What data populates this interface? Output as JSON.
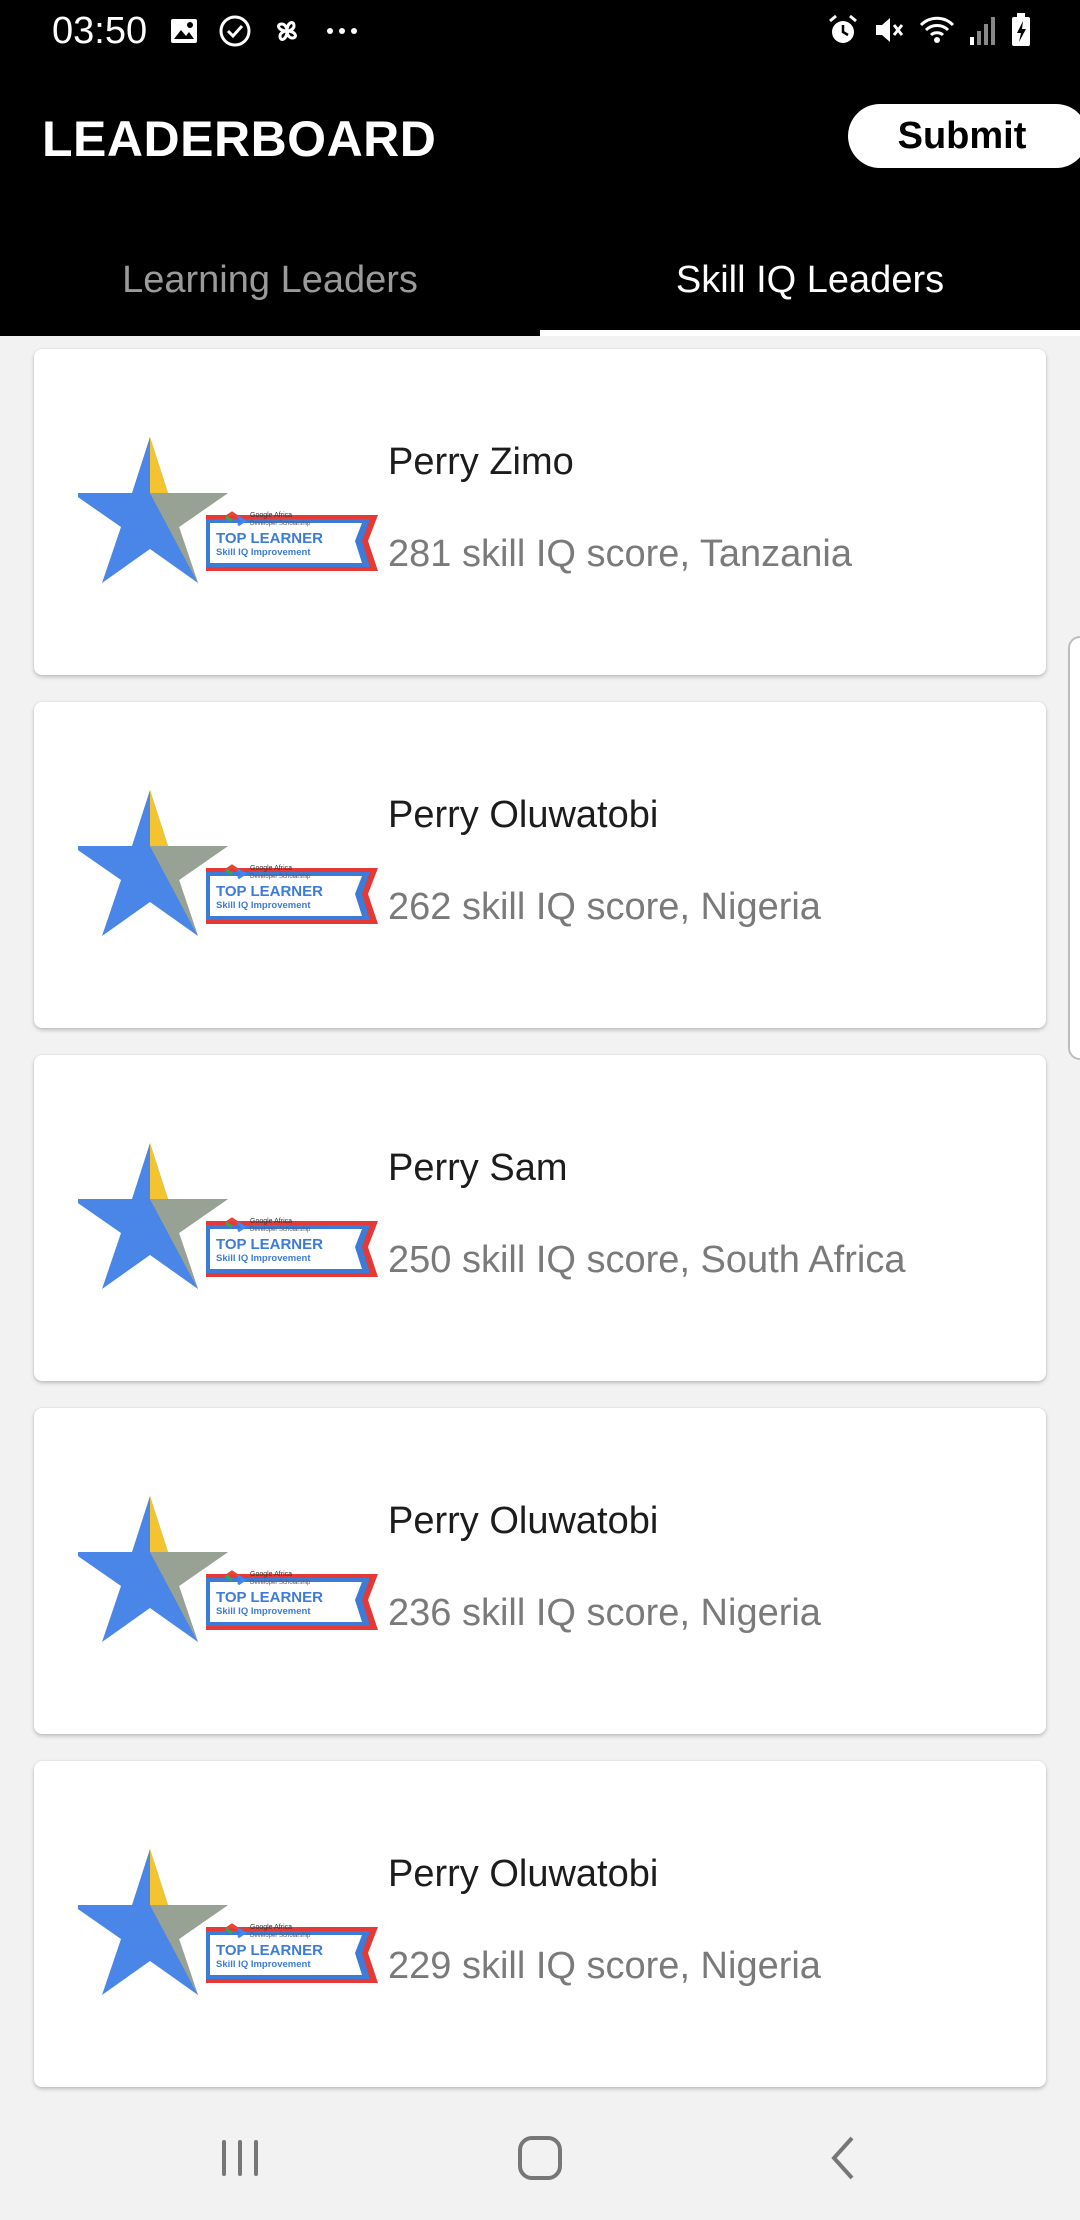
{
  "status_bar": {
    "time": "03:50",
    "left_icons": [
      "image-icon",
      "check-circle-icon",
      "pinwheel-icon",
      "more-dots-icon"
    ],
    "right_icons": [
      "alarm-icon",
      "mute-icon",
      "wifi-icon",
      "signal-icon",
      "battery-icon"
    ]
  },
  "app_bar": {
    "title": "LEADERBOARD",
    "submit_label": "Submit"
  },
  "tabs": [
    {
      "label": "Learning Leaders",
      "selected": false
    },
    {
      "label": "Skill IQ Leaders",
      "selected": true
    }
  ],
  "badge": {
    "brand_line1": "Google Africa",
    "brand_line2": "Developer Scholarship",
    "title": "TOP LEARNER",
    "subtitle": "Skill IQ Improvement",
    "colors": {
      "star_blue": "#4a86e8",
      "star_yellow": "#f4c430",
      "ribbon_red": "#e53935",
      "ribbon_blue": "#3d7bd9"
    }
  },
  "leaders": [
    {
      "name": "Perry Zimo",
      "detail": "281 skill IQ score, Tanzania"
    },
    {
      "name": "Perry Oluwatobi",
      "detail": "262 skill IQ score, Nigeria"
    },
    {
      "name": "Perry Sam",
      "detail": "250 skill IQ score, South Africa"
    },
    {
      "name": "Perry Oluwatobi",
      "detail": "236 skill IQ score, Nigeria"
    },
    {
      "name": "Perry Oluwatobi",
      "detail": "229 skill IQ score, Nigeria"
    }
  ],
  "nav_bar": {
    "buttons": [
      "recents-icon",
      "home-icon",
      "back-icon"
    ]
  }
}
